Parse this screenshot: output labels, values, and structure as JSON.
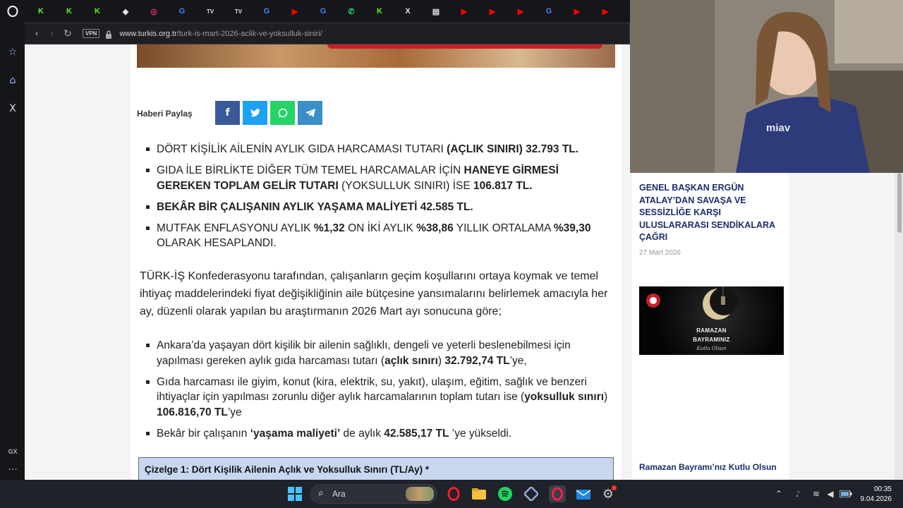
{
  "browser": {
    "tabs": [
      {
        "icon": "kick-icon",
        "glyph": "K",
        "color": "#53fc18"
      },
      {
        "icon": "kick-icon",
        "glyph": "K",
        "color": "#53fc18"
      },
      {
        "icon": "kick-icon",
        "glyph": "K",
        "color": "#53fc18"
      },
      {
        "icon": "trello-icon",
        "glyph": "◆",
        "color": "#e0e0e0"
      },
      {
        "icon": "instagram-icon",
        "glyph": "◎",
        "color": "#e1306c"
      },
      {
        "icon": "google-icon",
        "glyph": "G",
        "color": "#4285f4"
      },
      {
        "icon": "tv-icon",
        "glyph": "TV",
        "color": "#e0e0e0"
      },
      {
        "icon": "tv-icon",
        "glyph": "TV",
        "color": "#e0e0e0"
      },
      {
        "icon": "google-icon",
        "glyph": "G",
        "color": "#4285f4"
      },
      {
        "icon": "youtube-icon",
        "glyph": "▶",
        "color": "#ff0000"
      },
      {
        "icon": "google-icon",
        "glyph": "G",
        "color": "#4285f4"
      },
      {
        "icon": "whatsapp-icon",
        "glyph": "✆",
        "color": "#25d366"
      },
      {
        "icon": "kick-icon",
        "glyph": "K",
        "color": "#53fc18"
      },
      {
        "icon": "x-icon",
        "glyph": "X",
        "color": "#e0e0e0"
      },
      {
        "icon": "news-icon",
        "glyph": "▤",
        "color": "#e0e0e0"
      },
      {
        "icon": "youtube-icon",
        "glyph": "▶",
        "color": "#ff0000"
      },
      {
        "icon": "youtube-icon",
        "glyph": "▶",
        "color": "#ff0000"
      },
      {
        "icon": "youtube-icon",
        "glyph": "▶",
        "color": "#ff0000"
      },
      {
        "icon": "google-icon",
        "glyph": "G",
        "color": "#4285f4"
      },
      {
        "icon": "youtube-icon",
        "glyph": "▶",
        "color": "#ff0000"
      },
      {
        "icon": "youtube-icon",
        "glyph": "▶",
        "color": "#ff0000"
      }
    ],
    "vpn_label": "VPN",
    "url_domain": "www.turkis.org.tr",
    "url_path": "/turk-is-mart-2026-aclik-ve-yoksulluk-siniri/",
    "sidebar_gx": "GX",
    "sidebar_more": "···"
  },
  "article": {
    "share_label": "Haberi Paylaş",
    "bullets_top": [
      [
        {
          "t": "DÖRT KİŞİLİK AİLENİN AYLIK GIDA HARCAMASI TUTARI "
        },
        {
          "t": "(AÇLIK SINIRI) 32.793 TL.",
          "b": true
        }
      ],
      [
        {
          "t": "GIDA İLE BİRLİKTE DİĞER TÜM TEMEL HARCAMALAR İÇİN "
        },
        {
          "t": "HANEYE GİRMESİ GEREKEN TOPLAM GELİR TUTARI",
          "b": true
        },
        {
          "t": " (YOKSULLUK SINIRI) İSE "
        },
        {
          "t": "106.817 TL.",
          "b": true
        }
      ],
      [
        {
          "t": "BEKÂR BİR ÇALIŞANIN AYLIK YAŞAMA MALİYETİ 42.585 TL.",
          "b": true
        }
      ],
      [
        {
          "t": "MUTFAK ENFLASYONU AYLIK "
        },
        {
          "t": "%1,32",
          "b": true
        },
        {
          "t": " ON İKİ AYLIK "
        },
        {
          "t": "%38,86",
          "b": true
        },
        {
          "t": " YILLIK ORTALAMA "
        },
        {
          "t": "%39,30",
          "b": true
        },
        {
          "t": " OLARAK HESAPLANDI."
        }
      ]
    ],
    "paragraph": "TÜRK-İŞ Konfederasyonu tarafından, çalışanların geçim koşullarını ortaya koymak ve temel ihtiyaç maddelerindeki fiyat değişikliğinin aile bütçesine yansımalarını belirlemek amacıyla her ay, düzenli olarak yapılan bu araştırmanın 2026 Mart ayı sonucuna göre;",
    "bullets_bottom": [
      [
        {
          "t": "Ankara’da yaşayan dört kişilik bir ailenin sağlıklı, dengeli ve yeterli beslenebilmesi için yapılması gereken aylık gıda harcaması tutarı ("
        },
        {
          "t": "açlık sınırı",
          "b": true
        },
        {
          "t": ") "
        },
        {
          "t": "32.792,74 TL",
          "b": true
        },
        {
          "t": "’ye,"
        }
      ],
      [
        {
          "t": "Gıda harcaması ile giyim, konut (kira, elektrik, su, yakıt), ulaşım, eğitim, sağlık ve benzeri ihtiyaçlar için yapılması zorunlu diğer aylık harcamalarının toplam tutarı ise ("
        },
        {
          "t": "yoksulluk sınırı",
          "b": true
        },
        {
          "t": ") "
        },
        {
          "t": "106.816,70 TL",
          "b": true
        },
        {
          "t": "’ye"
        }
      ],
      [
        {
          "t": "Bekâr bir çalışanın "
        },
        {
          "t": "‘yaşama maliyeti’",
          "b": true
        },
        {
          "t": " de aylık "
        },
        {
          "t": "42.585,17 TL",
          "b": true
        },
        {
          "t": " ’ye yükseldi."
        }
      ]
    ],
    "table_title": "Çizelge 1: Dört Kişilik Ailenin Açlık ve Yoksulluk Sınırı (TL/Ay) *"
  },
  "right_column": {
    "news_title": "GENEL BAŞKAN ERGÜN ATALAY’DAN SAVAŞA VE SESSİZLİĞE KARŞI ULUSLARARASI SENDİKALARA ÇAĞRI",
    "news_date": "27 Mart 2026",
    "banner_line1": "RAMAZAN",
    "banner_line2": "BAYRAMINIZ",
    "banner_line3": "Kutlu Olsun",
    "news_title2": "Ramazan Bayramı’nız Kutlu Olsun"
  },
  "taskbar": {
    "search_label": "Ara",
    "time": "00:35",
    "date": "9.04.2026"
  },
  "colors": {
    "facebook": "#3b5998",
    "twitter": "#1da1f2",
    "whatsapp": "#25d366",
    "telegram": "#3a8fc8",
    "table_header_bg": "#c8d7ef",
    "news_title": "#1b2d6b"
  }
}
